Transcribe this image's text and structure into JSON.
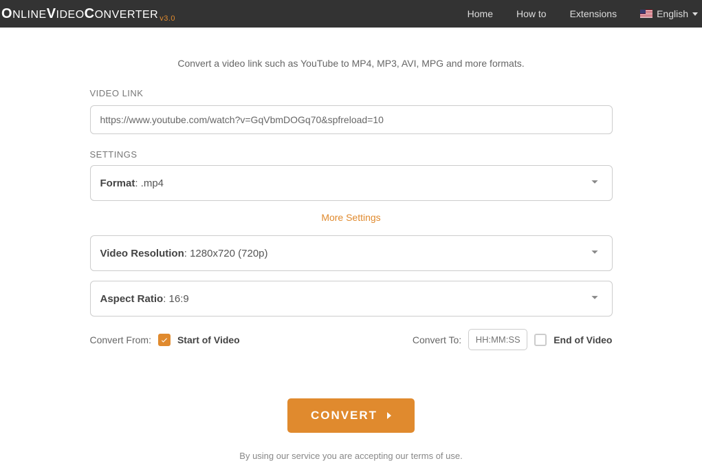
{
  "header": {
    "logo_parts": {
      "o": "O",
      "nline": "NLINE",
      "v": "V",
      "ideo": "IDEO",
      "c": "C",
      "onverter": "ONVERTER"
    },
    "version": "v3.0",
    "nav": {
      "home": "Home",
      "howto": "How to",
      "extensions": "Extensions"
    },
    "lang_label": "English"
  },
  "subtitle": "Convert a video link such as YouTube to MP4, MP3, AVI, MPG and more formats.",
  "video_link": {
    "label": "VIDEO LINK",
    "value": "https://www.youtube.com/watch?v=GqVbmDOGq70&spfreload=10"
  },
  "settings": {
    "label": "SETTINGS",
    "format": {
      "key": "Format",
      "value": ": .mp4"
    },
    "more": "More Settings",
    "resolution": {
      "key": "Video Resolution",
      "value": ": 1280x720 (720p)"
    },
    "aspect": {
      "key": "Aspect Ratio",
      "value": ": 16:9"
    }
  },
  "time": {
    "from_label": "Convert From:",
    "start_label": "Start of Video",
    "to_label": "Convert To:",
    "placeholder": "HH:MM:SS",
    "end_label": "End of Video"
  },
  "convert_label": "CONVERT",
  "terms": "By using our service you are accepting our terms of use."
}
